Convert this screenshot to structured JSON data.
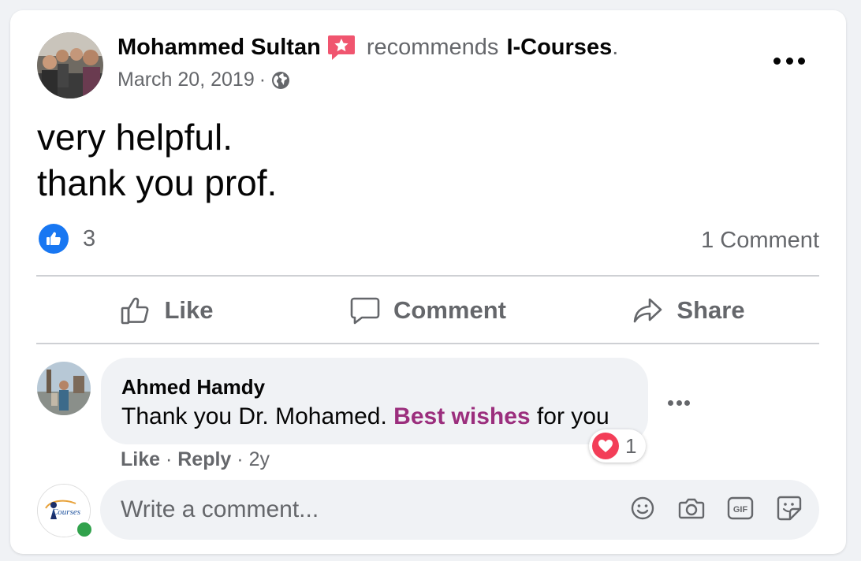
{
  "post": {
    "author": "Mohammed Sultan",
    "action": "recommends",
    "page": "I-Courses",
    "page_suffix": ".",
    "date": "March 20, 2019",
    "separator": "·",
    "lines": [
      "very helpful.",
      "thank you prof."
    ],
    "reaction_count": "3",
    "comment_count": "1 Comment"
  },
  "actions": {
    "like": "Like",
    "comment": "Comment",
    "share": "Share"
  },
  "comment": {
    "author": "Ahmed Hamdy",
    "text_before": "Thank you Dr. Mohamed. ",
    "text_highlight": "Best wishes",
    "text_after": " for you",
    "heart_count": "1",
    "like": "Like",
    "reply": "Reply",
    "dot": " · ",
    "age": "2y"
  },
  "composer": {
    "placeholder": "Write a comment...",
    "avatar_text": "Courses",
    "icons": [
      "emoji-icon",
      "camera-icon",
      "gif-icon",
      "sticker-icon"
    ],
    "gif_label": "GIF"
  },
  "colors": {
    "brand_blue": "#1877f2",
    "highlight_purple": "#9b2e7d",
    "heart_red": "#f33e58",
    "online_green": "#31a24c",
    "recommend_red": "#f0556f"
  }
}
